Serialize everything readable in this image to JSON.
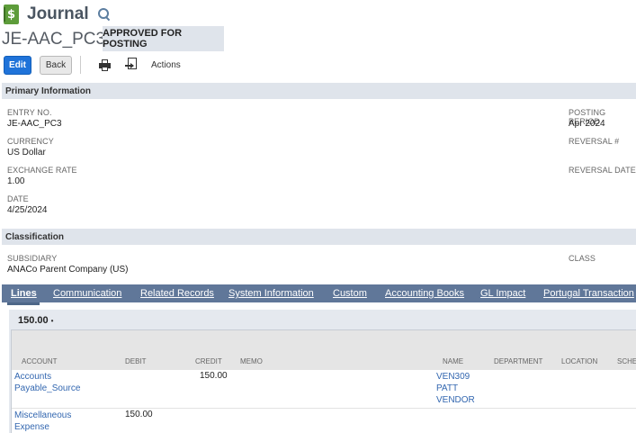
{
  "header": {
    "icon_glyph": "$",
    "icon_name": "journal-icon",
    "title": "Journal",
    "record_id": "JE-AAC_PC3",
    "status": "APPROVED FOR POSTING"
  },
  "toolbar": {
    "edit_label": "Edit",
    "back_label": "Back",
    "print_icon": "printer-icon",
    "export_icon": "export-icon",
    "actions_label": "Actions"
  },
  "primary": {
    "title": "Primary Information",
    "entry_no_label": "ENTRY NO.",
    "entry_no_value": "JE-AAC_PC3",
    "currency_label": "CURRENCY",
    "currency_value": "US Dollar",
    "exchange_rate_label": "EXCHANGE RATE",
    "exchange_rate_value": "1.00",
    "date_label": "DATE",
    "date_value": "4/25/2024",
    "posting_period_label": "POSTING PERIOD",
    "posting_period_value": "Apr 2024",
    "reversal_no_label": "REVERSAL #",
    "reversal_date_label": "REVERSAL DATE"
  },
  "classification": {
    "title": "Classification",
    "subsidiary_label": "SUBSIDIARY",
    "subsidiary_value": "ANACo Parent Company (US)",
    "class_label": "CLASS"
  },
  "tabs": [
    {
      "label": "Lines",
      "active": true
    },
    {
      "label": "Communication"
    },
    {
      "label": "Related Records"
    },
    {
      "label": "System Information"
    },
    {
      "label": "Custom"
    },
    {
      "label": "Accounting Books"
    },
    {
      "label": "GL Impact"
    },
    {
      "label": "Portugal Transaction"
    }
  ],
  "lines": {
    "total": "150.00",
    "total_marker": "•",
    "columns": [
      "ACCOUNT",
      "DEBIT",
      "CREDIT",
      "MEMO",
      "NAME",
      "DEPARTMENT",
      "LOCATION",
      "SCHE"
    ],
    "rows": [
      {
        "account_1": "Accounts",
        "account_2": "Payable_Source",
        "debit": "",
        "credit": "150.00",
        "name_1": "VEN309",
        "name_2": "PATT",
        "name_3": "VENDOR"
      },
      {
        "account_1": "Miscellaneous",
        "account_2": "Expense",
        "debit": "150.00",
        "credit": "",
        "name_1": "",
        "name_2": "",
        "name_3": ""
      }
    ]
  }
}
